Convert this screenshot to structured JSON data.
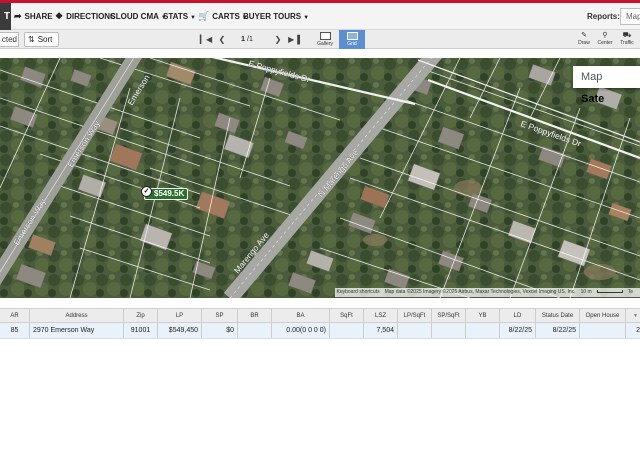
{
  "toolbar": {
    "left_tab": "T",
    "share": "SHARE",
    "directions": "DIRECTIONS",
    "cloud_cma": "CLOUD CMA",
    "stats": "STATS",
    "carts": "CARTS",
    "buyer_tours": "BUYER TOURS",
    "reports_label": "Reports:",
    "reports_value": "Map"
  },
  "subbar": {
    "selected_label": "cted",
    "sort_label": "Sort",
    "page_current": "1",
    "page_total": "/1",
    "gallery_label": "Gallery",
    "grid_label": "Grid",
    "draw_label": "Draw",
    "center_label": "Center",
    "traffic_label": "Traffic"
  },
  "map": {
    "map_btn": "Map",
    "satellite_btn": "Sate",
    "pin_price": "$549.5K",
    "streets": {
      "emerson_a": "Emerson Way",
      "emerson_b": "Emerson Way",
      "emerson_c": "Emerson",
      "poppy_top": "E Poppyfields Dr",
      "poppy_right": "E Poppyfields Dr",
      "marengo_n": "N Marengo Ave",
      "marengo": "Marengo Ave"
    },
    "attribution": {
      "shortcuts": "Keyboard shortcuts",
      "data": "Map data ©2025 Imagery ©2025 Airbus, Maxar Technologies, Vexcel Imaging US, Inc.",
      "scale": "10 m",
      "terms": "Te"
    }
  },
  "grid": {
    "columns": [
      "AR",
      "Address",
      "Zip",
      "LP",
      "SP",
      "BR",
      "BA",
      "SqFt",
      "LSZ",
      "LP/SqFt",
      "SP/SqFt",
      "YB",
      "LD",
      "Status Date",
      "Open House",
      ""
    ],
    "rows": [
      {
        "ar": "85",
        "address": "2970 Emerson Way",
        "zip": "91001",
        "lp": "$549,450",
        "sp": "$0",
        "br": "",
        "ba": "0.00(0 0 0 0)",
        "sqft": "",
        "lsz": "7,504",
        "lp_sqft": "",
        "sp_sqft": "",
        "yb": "",
        "ld": "8/22/25",
        "status_date": "8/22/25",
        "open_house": "",
        "extra": "2"
      }
    ]
  },
  "colors": {
    "accent_red": "#c8102e",
    "active_view": "#5b8fd0",
    "pin_green": "#27722c",
    "row_highlight": "#e9f1fb"
  }
}
